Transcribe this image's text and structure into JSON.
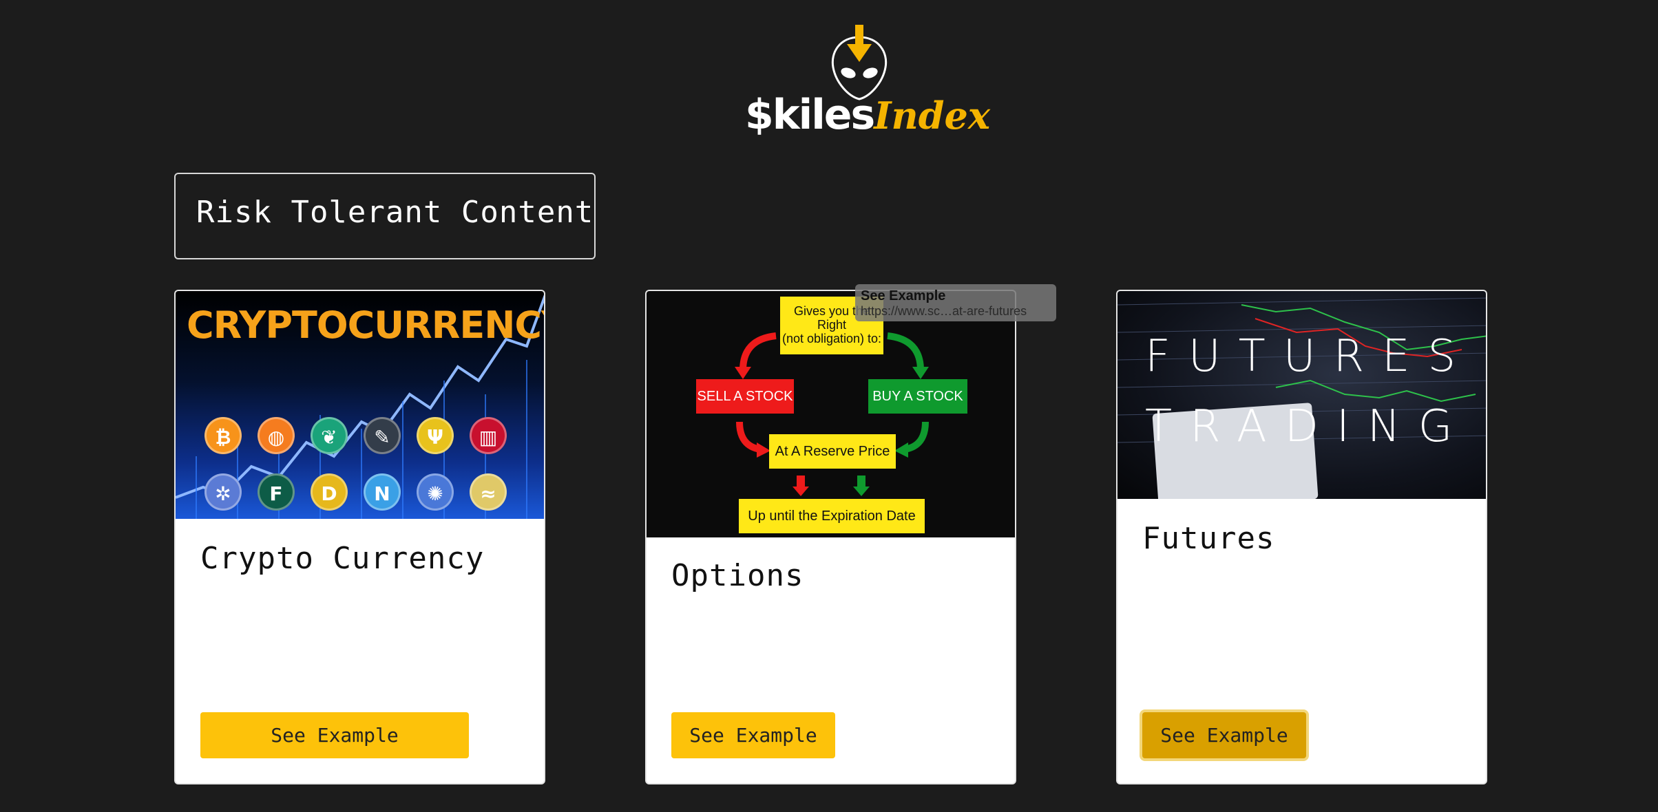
{
  "logo": {
    "brand": "$kiles",
    "suffix": "Index"
  },
  "section": {
    "title": "Risk Tolerant Content"
  },
  "cards": [
    {
      "title": "Crypto Currency",
      "button": "See Example",
      "image": {
        "heading": "CRYPTOCURRENCY",
        "coin_symbols": [
          "₿",
          "◍",
          "❦",
          "✎",
          "Ψ",
          "▥",
          "✲",
          "F",
          "D",
          "N",
          "✺",
          "≈"
        ]
      }
    },
    {
      "title": "Options",
      "button": "See Example",
      "image": {
        "top": "Gives you the Right\n(not obligation) to:",
        "sell": "SELL A STOCK",
        "buy": "BUY A STOCK",
        "reserve": "At A Reserve Price",
        "expiry": "Up until the Expiration Date"
      }
    },
    {
      "title": "Futures",
      "button": "See Example",
      "image": {
        "line1": "FUTURES",
        "line2": "TRADING"
      }
    }
  ],
  "tooltip": {
    "title": "See Example",
    "url": "https://www.sc…at-are-futures"
  },
  "colors": {
    "background": "#1c1c1c",
    "accent": "#fdc20a",
    "logo_accent": "#f5b400"
  }
}
